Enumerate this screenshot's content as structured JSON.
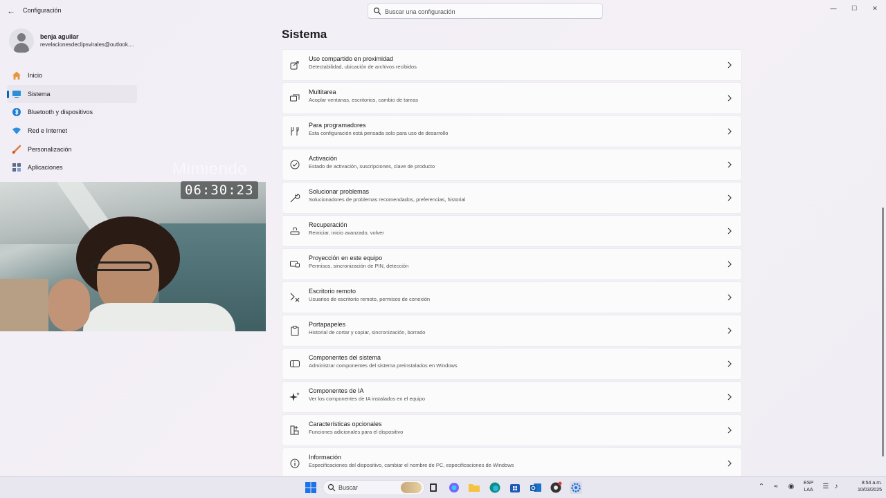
{
  "window": {
    "app_title": "Configuración",
    "search_placeholder": "Buscar una configuración",
    "minimize": "—",
    "maximize": "☐",
    "close": "✕"
  },
  "user": {
    "name": "benja aguilar",
    "email": "revelacionesdeclipsvirales@outlook...."
  },
  "sidebar": {
    "items": [
      {
        "label": "Inicio",
        "icon": "home-icon",
        "active": false
      },
      {
        "label": "Sistema",
        "icon": "system-icon",
        "active": true
      },
      {
        "label": "Bluetooth y dispositivos",
        "icon": "bluetooth-icon",
        "active": false
      },
      {
        "label": "Red e Internet",
        "icon": "wifi-icon",
        "active": false
      },
      {
        "label": "Personalización",
        "icon": "brush-icon",
        "active": false
      },
      {
        "label": "Aplicaciones",
        "icon": "apps-icon",
        "active": false
      }
    ]
  },
  "overlay": {
    "label": "Mimiendo",
    "timer": "06:30:23"
  },
  "main": {
    "title": "Sistema",
    "cards": [
      {
        "title": "Uso compartido en proximidad",
        "subtitle": "Detectabilidad, ubicación de archivos recibidos",
        "icon": "share-icon"
      },
      {
        "title": "Multitarea",
        "subtitle": "Acoplar ventanas, escritorios, cambio de tareas",
        "icon": "multitask-icon"
      },
      {
        "title": "Para programadores",
        "subtitle": "Esta configuración está pensada solo para uso de desarrollo",
        "icon": "developer-tools-icon"
      },
      {
        "title": "Activación",
        "subtitle": "Estado de activación, suscripciones, clave de producto",
        "icon": "check-circle-icon"
      },
      {
        "title": "Solucionar problemas",
        "subtitle": "Solucionadores de problemas recomendados, preferencias, historial",
        "icon": "wrench-icon"
      },
      {
        "title": "Recuperación",
        "subtitle": "Reiniciar, inicio avanzado, volver",
        "icon": "recovery-icon"
      },
      {
        "title": "Proyección en este equipo",
        "subtitle": "Permisos, sincronización de PIN, detección",
        "icon": "projection-icon"
      },
      {
        "title": "Escritorio remoto",
        "subtitle": "Usuarios de escritorio remoto, permisos de conexión",
        "icon": "remote-desktop-icon"
      },
      {
        "title": "Portapapeles",
        "subtitle": "Historial de cortar y copiar, sincronización, borrado",
        "icon": "clipboard-icon"
      },
      {
        "title": "Componentes del sistema",
        "subtitle": "Administrar componentes del sistema preinstalados en Windows",
        "icon": "components-icon"
      },
      {
        "title": "Componentes de IA",
        "subtitle": "Ver los componentes de IA instalados en el equipo",
        "icon": "sparkle-icon"
      },
      {
        "title": "Características opcionales",
        "subtitle": "Funciones adicionales para el dispositivo",
        "icon": "optional-features-icon"
      },
      {
        "title": "Información",
        "subtitle": "Especificaciones del dispositivo, cambiar el nombre de PC, especificaciones de Windows",
        "icon": "info-icon"
      }
    ]
  },
  "taskbar": {
    "search_label": "Buscar",
    "language_top": "ESP",
    "language_bottom": "LAA",
    "time": "8:54 a.m.",
    "date": "10/03/2025",
    "accent": "#0067c0"
  }
}
